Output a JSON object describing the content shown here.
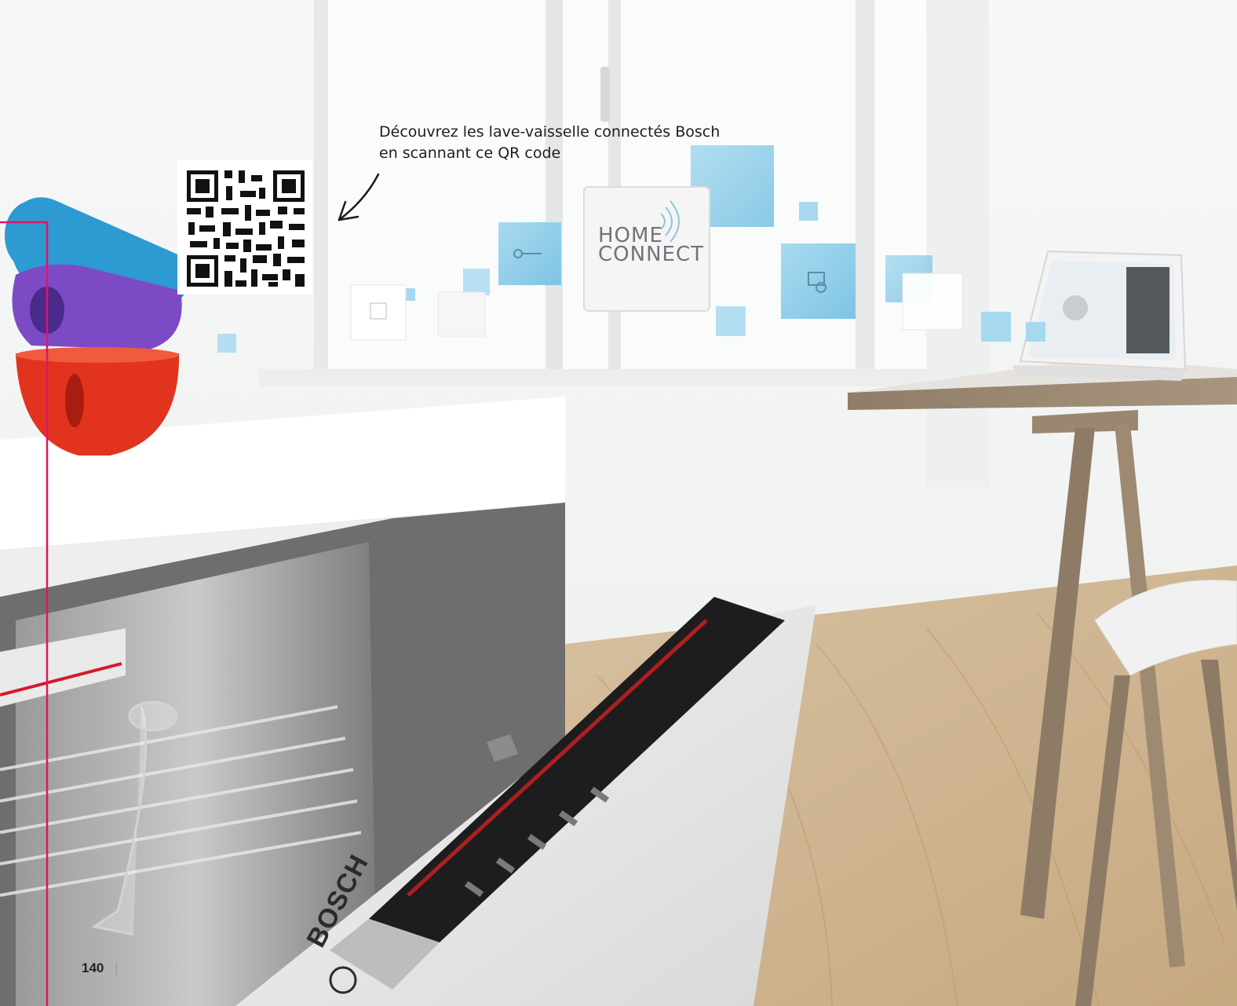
{
  "caption": {
    "line1": "Découvrez les lave-vaisselle connectés Bosch",
    "line2": "en scannant ce QR code"
  },
  "home_connect": {
    "line1": "Home",
    "line2": "connect"
  },
  "appliance": {
    "brand": "BOSCH"
  },
  "page": {
    "number": "140",
    "separator": "|"
  },
  "colors": {
    "accent_line": "#e0146b",
    "tile_blue": "#8fcde8",
    "cup_blue": "#2f9bd3",
    "cup_purple": "#7e4ac7",
    "cup_red": "#e0321e"
  }
}
